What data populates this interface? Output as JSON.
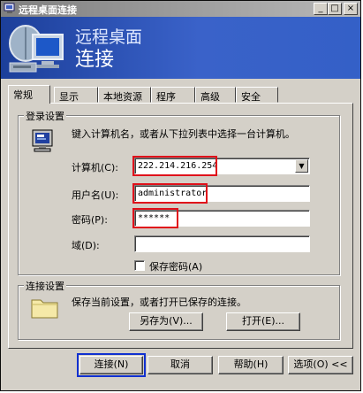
{
  "window": {
    "title": "远程桌面连接",
    "controls": {
      "minimize": "_",
      "maximize": "□",
      "close": "×"
    }
  },
  "banner": {
    "line1": "远程桌面",
    "line2": "连接"
  },
  "tabs": [
    {
      "label": "常规",
      "active": true
    },
    {
      "label": "显示",
      "active": false
    },
    {
      "label": "本地资源",
      "active": false
    },
    {
      "label": "程序",
      "active": false
    },
    {
      "label": "高级",
      "active": false
    },
    {
      "label": "安全",
      "active": false
    }
  ],
  "login": {
    "group_title": "登录设置",
    "instruction": "键入计算机名，或者从下拉列表中选择一台计算机。",
    "computer_label": "计算机(C):",
    "computer_value": "222.214.216.254",
    "username_label": "用户名(U):",
    "username_value": "administrator",
    "password_label": "密码(P):",
    "password_value": "******",
    "domain_label": "域(D):",
    "domain_value": "",
    "save_password_label": "保存密码(A)"
  },
  "connection": {
    "group_title": "连接设置",
    "instruction": "保存当前设置，或者打开已保存的连接。",
    "save_as_label": "另存为(V)...",
    "open_label": "打开(E)..."
  },
  "footer": {
    "connect_label": "连接(N)",
    "cancel_label": "取消",
    "help_label": "帮助(H)",
    "options_label": "选项(O) <<"
  },
  "colors": {
    "highlight_red": "#e0101a",
    "highlight_blue": "#1030d0",
    "banner_blue": "#2f56bd"
  }
}
